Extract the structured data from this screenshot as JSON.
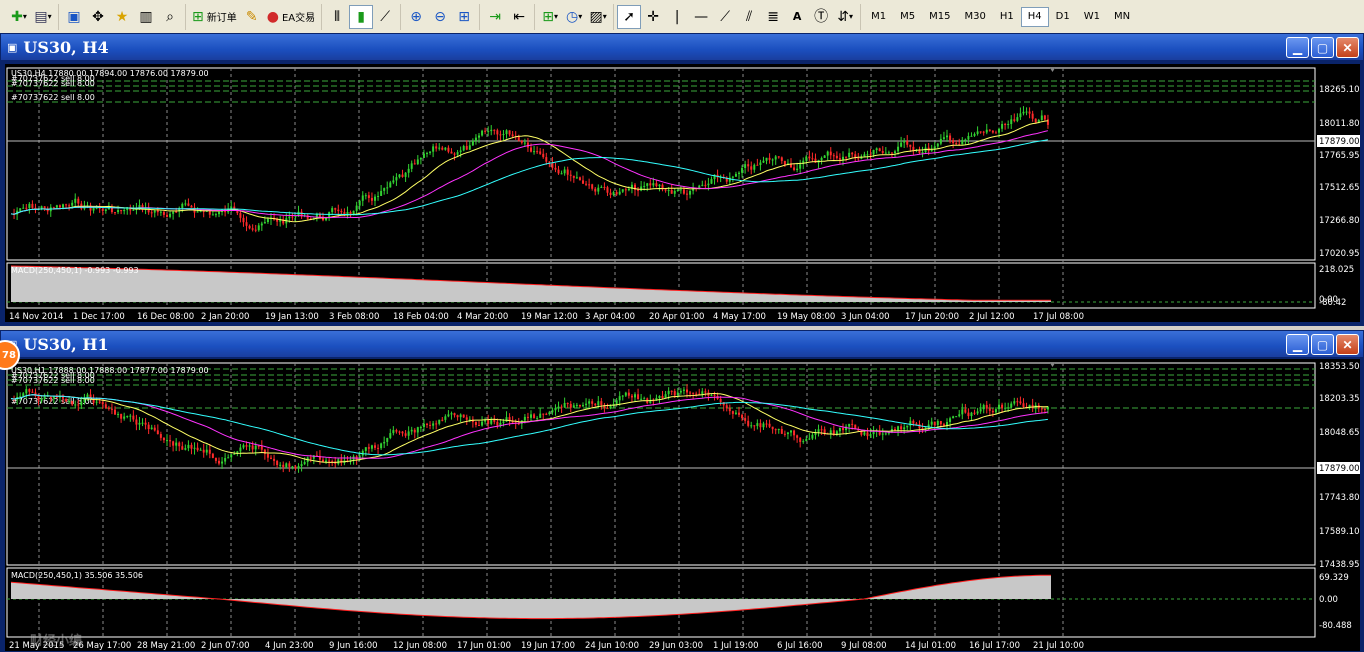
{
  "toolbar": {
    "new_order_label": "新订单",
    "ea_label": "EA交易",
    "timeframes": [
      "M1",
      "M5",
      "M15",
      "M30",
      "H1",
      "H4",
      "D1",
      "W1",
      "MN"
    ],
    "active_timeframe": "H4"
  },
  "window_h4": {
    "title": "US30, H4",
    "header_line": "US30,H4 17880.00 17894.00 17876.00 17879.00",
    "orders": [
      "#70737622 sell 8.00",
      "#70737622 sell 8.00",
      "#70737622 sell 8.00"
    ],
    "price_labels": [
      "18265.10",
      "18011.80",
      "17879.00",
      "17765.95",
      "17512.65",
      "17266.80",
      "17020.95"
    ],
    "current_price": "17879.00",
    "macd_label": "MACD(250,450,1) -0.993 -0.993",
    "macd_scale": [
      "218.025",
      "0.00",
      "-80.42"
    ],
    "time_labels": [
      "14 Nov 2014",
      "1 Dec 17:00",
      "16 Dec 08:00",
      "2 Jan 20:00",
      "19 Jan 13:00",
      "3 Feb 08:00",
      "18 Feb 04:00",
      "4 Mar 20:00",
      "19 Mar 12:00",
      "3 Apr 04:00",
      "20 Apr 01:00",
      "4 May 17:00",
      "19 May 08:00",
      "3 Jun 04:00",
      "17 Jun 20:00",
      "2 Jul 12:00",
      "17 Jul 08:00"
    ]
  },
  "window_h1": {
    "title": "US30, H1",
    "header_line": "US30,H1 17888.00 17888.00 17877.00 17879.00",
    "orders": [
      "#70737622 sell 8.00",
      "#70737622 sell 8.00",
      "#70737622 sell 8.00"
    ],
    "price_labels": [
      "18353.50",
      "18203.35",
      "18048.65",
      "17879.00",
      "17743.80",
      "17589.10",
      "17438.95"
    ],
    "current_price": "17879.00",
    "macd_label": "MACD(250,450,1) 35.506 35.506",
    "macd_scale": [
      "69.329",
      "0.00",
      "-80.488"
    ],
    "time_labels": [
      "21 May 2015",
      "26 May 17:00",
      "28 May 21:00",
      "2 Jun 07:00",
      "4 Jun 23:00",
      "9 Jun 16:00",
      "12 Jun 08:00",
      "17 Jun 01:00",
      "19 Jun 17:00",
      "24 Jun 10:00",
      "29 Jun 03:00",
      "1 Jul 19:00",
      "6 Jul 16:00",
      "9 Jul 08:00",
      "14 Jul 01:00",
      "16 Jul 17:00",
      "21 Jul 10:00"
    ],
    "badge": "78"
  },
  "watermark": "财经小编"
}
